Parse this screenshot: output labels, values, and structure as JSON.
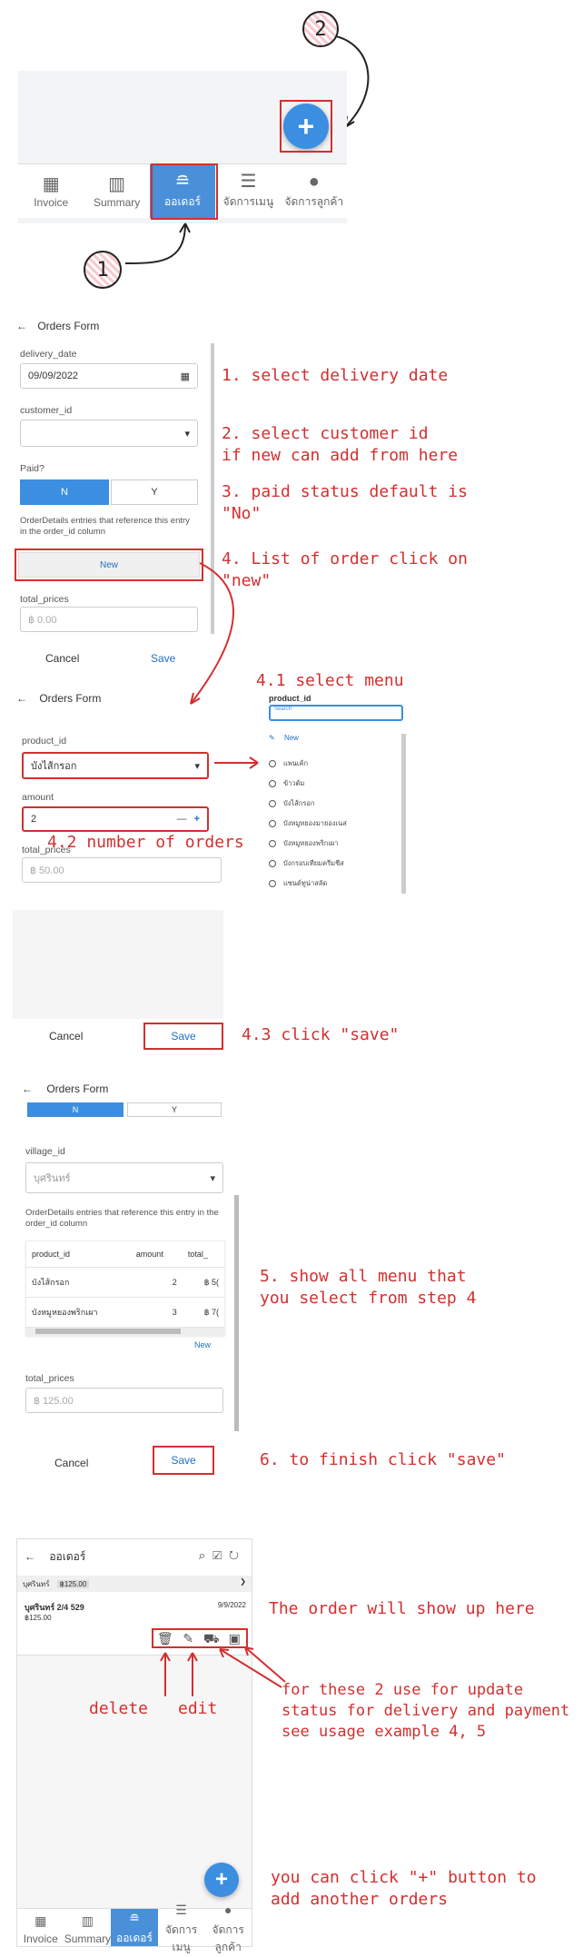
{
  "step1": {
    "nav": [
      {
        "label": "Invoice",
        "icon": "calendar-icon",
        "glyph": "▦"
      },
      {
        "label": "Summary",
        "icon": "chart-icon",
        "glyph": "▥"
      },
      {
        "label": "ออเดอร์",
        "icon": "burger-icon",
        "glyph": "≘"
      },
      {
        "label": "จัดการเมนู",
        "icon": "menu-lines-icon",
        "glyph": "☰"
      },
      {
        "label": "จัดการลูกค้า",
        "icon": "person-icon",
        "glyph": "●"
      }
    ],
    "fab": "+",
    "marker1": "1",
    "marker2": "2"
  },
  "form1": {
    "title": "Orders Form",
    "delivery_label": "delivery_date",
    "delivery_value": "09/09/2022",
    "customer_label": "customer_id",
    "paid_label": "Paid?",
    "paid_n": "N",
    "paid_y": "Y",
    "details_text": "OrderDetails entries that reference this entry in the order_id column",
    "new_btn": "New",
    "total_label": "total_prices",
    "total_value": "฿ 0.00",
    "cancel": "Cancel",
    "save": "Save"
  },
  "notes1": {
    "n1": "1. select delivery date",
    "n2": "2. select customer id\nif new can add from here",
    "n3": "3. paid status default is\n\"No\"",
    "n4": "4. List of order click on\n\"new\""
  },
  "form2": {
    "title": "Orders Form",
    "product_label": "product_id",
    "product_value": "บังไส้กรอก",
    "amount_label": "amount",
    "amount_value": "2",
    "minus": "—",
    "plus": "+",
    "total_label": "total_prices",
    "total_value": "฿ 50.00",
    "cancel": "Cancel",
    "save": "Save"
  },
  "picker": {
    "label": "product_id",
    "search": "Search",
    "new": "New",
    "items": [
      "แพนเค้ก",
      "ข้าวต้ม",
      "บังไส้กรอก",
      "บังหมูหยองมายองเนส",
      "บังหมูหยองพริกเผา",
      "บังกรอบเทียมครีมชีส",
      "แซนด์ทูน่าสลัด"
    ]
  },
  "notes2": {
    "n41": "4.1 select menu",
    "n42": "4.2 number of orders",
    "n43": "4.3 click \"save\""
  },
  "form3": {
    "title": "Orders Form",
    "paid_n": "N",
    "paid_y": "Y",
    "village_label": "village_id",
    "village_value": "บุศรินทร์",
    "details_text": "OrderDetails entries that reference this entry in the order_id column",
    "columns": [
      "product_id",
      "amount",
      "total_"
    ],
    "rows": [
      [
        "บังไส้กรอก",
        "2",
        "฿ 5("
      ],
      [
        "บังหมูหยองพริกเผา",
        "3",
        "฿ 7("
      ]
    ],
    "new_link": "New",
    "total_label": "total_prices",
    "total_value": "฿ 125.00",
    "cancel": "Cancel",
    "save": "Save"
  },
  "notes3": {
    "n5": "5. show all menu that\nyou select from step 4",
    "n6": "6. to finish click \"save\""
  },
  "list": {
    "title": "ออเดอร์",
    "filter_village": "บุศรินทร์",
    "filter_total": "฿125.00",
    "order_title": "บุศรินทร์ 2/4 529",
    "order_date": "9/9/2022",
    "order_total": "฿125.00",
    "fab": "+",
    "nav": [
      {
        "label": "Invoice",
        "icon": "calendar-icon",
        "glyph": "▦"
      },
      {
        "label": "Summary",
        "icon": "chart-icon",
        "glyph": "▥"
      },
      {
        "label": "ออเดอร์",
        "icon": "burger-icon",
        "glyph": "≘"
      },
      {
        "label": "จัดการเมนู",
        "icon": "menu-lines-icon",
        "glyph": "☰"
      },
      {
        "label": "จัดการลูกค้า",
        "icon": "person-icon",
        "glyph": "●"
      }
    ]
  },
  "notes4": {
    "show": "The order will show up here",
    "delete": "delete",
    "edit": "edit",
    "status": "for these 2 use for update\nstatus for delivery and payment\nsee usage example 4, 5",
    "plus": "you can click \"+\" button to\nadd another orders"
  }
}
